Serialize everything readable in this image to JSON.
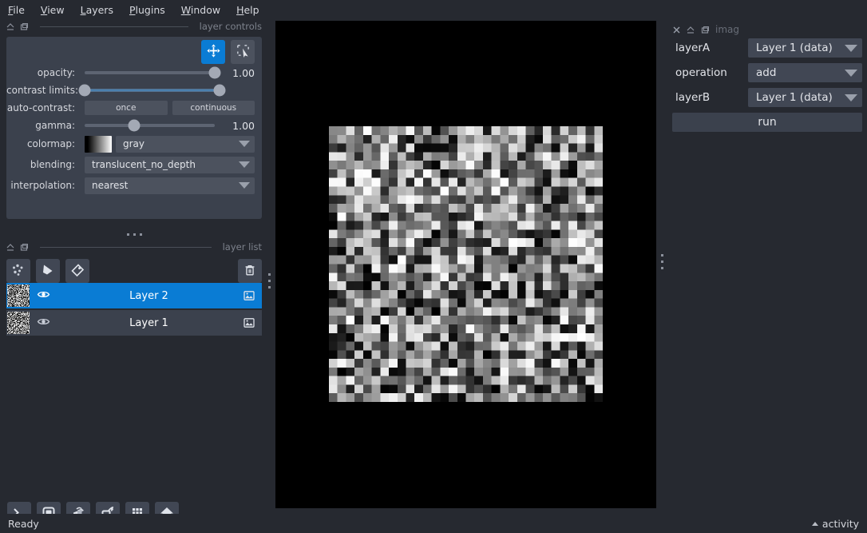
{
  "menu": {
    "items": [
      {
        "label": "File",
        "mnemonic": "F"
      },
      {
        "label": "View",
        "mnemonic": "V"
      },
      {
        "label": "Layers",
        "mnemonic": "L"
      },
      {
        "label": "Plugins",
        "mnemonic": "P"
      },
      {
        "label": "Window",
        "mnemonic": "W"
      },
      {
        "label": "Help",
        "mnemonic": "H"
      }
    ]
  },
  "layer_controls": {
    "dock_title": "layer controls",
    "mode_buttons": [
      {
        "name": "pan-zoom",
        "active": true
      },
      {
        "name": "transform",
        "active": false
      }
    ],
    "opacity": {
      "label": "opacity:",
      "value": "1.00",
      "fraction": 1.0
    },
    "contrast_limits": {
      "label": "contrast limits:",
      "low": 0.0,
      "high": 1.0
    },
    "auto_contrast": {
      "label": "auto-contrast:",
      "once": "once",
      "continuous": "continuous"
    },
    "gamma": {
      "label": "gamma:",
      "value": "1.00",
      "fraction": 0.38
    },
    "colormap": {
      "label": "colormap:",
      "value": "gray"
    },
    "blending": {
      "label": "blending:",
      "value": "translucent_no_depth"
    },
    "interpolation": {
      "label": "interpolation:",
      "value": "nearest"
    }
  },
  "layer_list": {
    "dock_title": "layer list",
    "buttons": [
      {
        "name": "new-points",
        "tooltip": "New points layer"
      },
      {
        "name": "new-shapes",
        "tooltip": "New shapes layer"
      },
      {
        "name": "new-labels",
        "tooltip": "New labels layer"
      }
    ],
    "delete_tooltip": "Delete selected layers",
    "layers": [
      {
        "name": "Layer 2",
        "visible": true,
        "selected": true,
        "type": "image"
      },
      {
        "name": "Layer 1",
        "visible": true,
        "selected": false,
        "type": "image"
      }
    ]
  },
  "viewer_buttons": [
    {
      "name": "console",
      "tooltip": "Open IPython console"
    },
    {
      "name": "ndisplay-2d",
      "tooltip": "Toggle 2D/3D view"
    },
    {
      "name": "roll-dims",
      "tooltip": "Roll dimensions"
    },
    {
      "name": "transpose-dims",
      "tooltip": "Transpose dimensions"
    },
    {
      "name": "grid-view",
      "tooltip": "Toggle grid view"
    },
    {
      "name": "home",
      "tooltip": "Reset view"
    }
  ],
  "plugin_dock": {
    "title": "imag",
    "rows": [
      {
        "label": "layerA",
        "value": "Layer 1 (data)"
      },
      {
        "label": "operation",
        "value": "add"
      },
      {
        "label": "layerB",
        "value": "Layer 1 (data)"
      }
    ],
    "run_label": "run"
  },
  "statusbar": {
    "status": "Ready",
    "activity": "activity"
  },
  "colors": {
    "background": "#262930",
    "panel": "#3b414d",
    "widget": "#4c525e",
    "accent": "#0a7cd4",
    "text": "#d6d8de",
    "muted": "#7d828c",
    "canvas": "#000000"
  },
  "canvas": {
    "image_description": "random grayscale noise, 32x32 pixels, nearest-neighbour upscaled"
  }
}
